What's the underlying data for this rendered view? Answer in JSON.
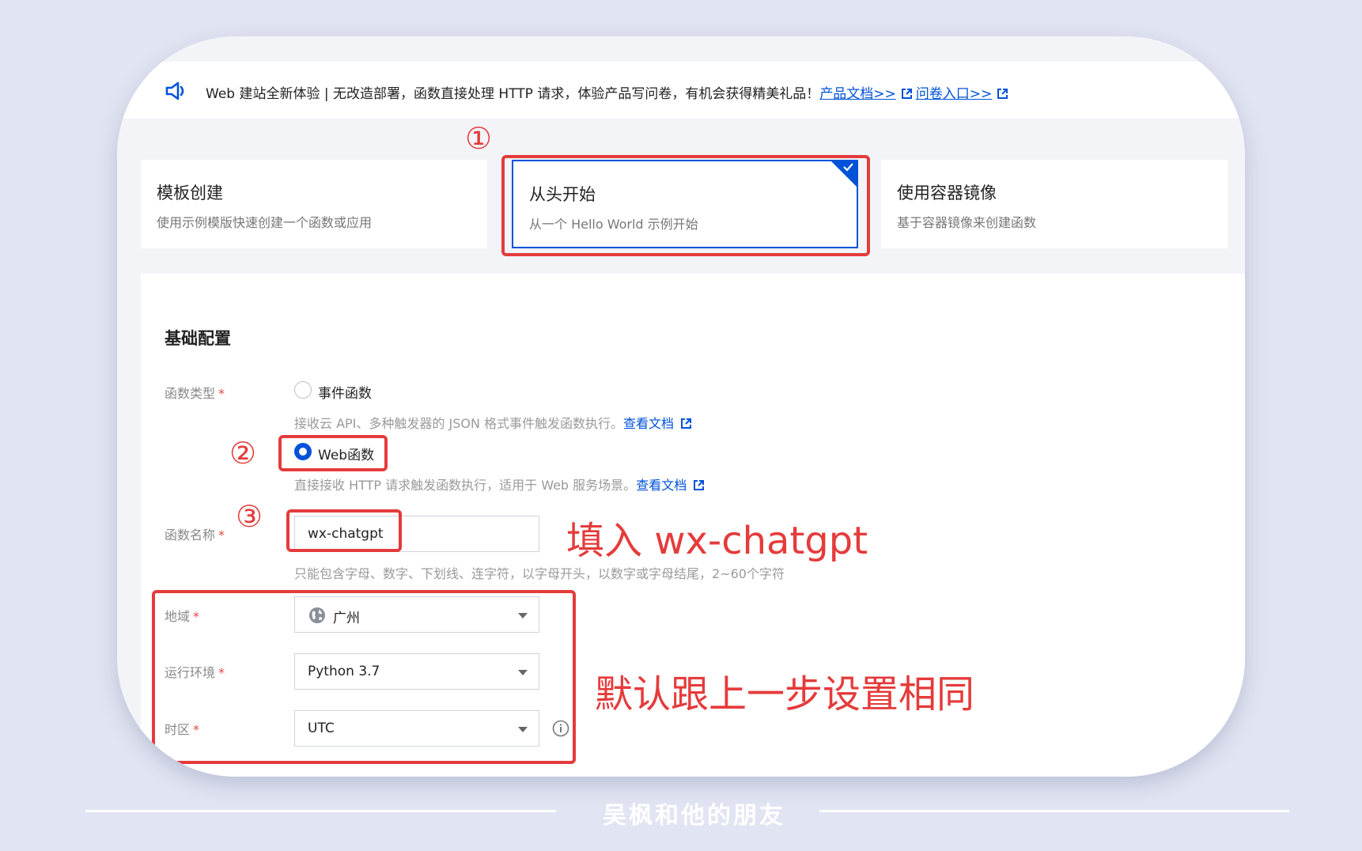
{
  "notice": {
    "text": "Web 建站全新体验 | 无改造部署，函数直接处理 HTTP 请求，体验产品写问卷，有机会获得精美礼品！",
    "link_docs": "产品文档>>",
    "link_survey": "问卷入口>>"
  },
  "cards": [
    {
      "title": "模板创建",
      "desc": "使用示例模版快速创建一个函数或应用"
    },
    {
      "title": "从头开始",
      "desc": "从一个 Hello World 示例开始"
    },
    {
      "title": "使用容器镜像",
      "desc": "基于容器镜像来创建函数"
    }
  ],
  "form": {
    "section_title": "基础配置",
    "func_type_label": "函数类型",
    "required_mark": "*",
    "option_event": "事件函数",
    "option_event_hint": "接收云 API、多种触发器的 JSON 格式事件触发函数执行。",
    "option_web": "Web函数",
    "option_web_hint": "直接接收 HTTP 请求触发函数执行，适用于 Web 服务场景。",
    "view_docs": "查看文档",
    "func_name_label": "函数名称",
    "func_name_value": "wx-chatgpt",
    "func_name_hint": "只能包含字母、数字、下划线、连字符，以字母开头，以数字或字母结尾，2~60个字符",
    "region_label": "地域",
    "region_value": "广州",
    "runtime_label": "运行环境",
    "runtime_value": "Python 3.7",
    "timezone_label": "时区",
    "timezone_value": "UTC"
  },
  "annotations": {
    "num1": "①",
    "num2": "②",
    "num3": "③",
    "fill_note": "填入 wx-chatgpt",
    "default_note": "默认跟上一步设置相同"
  },
  "footer": {
    "text": "吴枫和他的朋友"
  },
  "colors": {
    "accent": "#0052d9",
    "annotation": "#e53b3b",
    "required": "#e54545"
  }
}
